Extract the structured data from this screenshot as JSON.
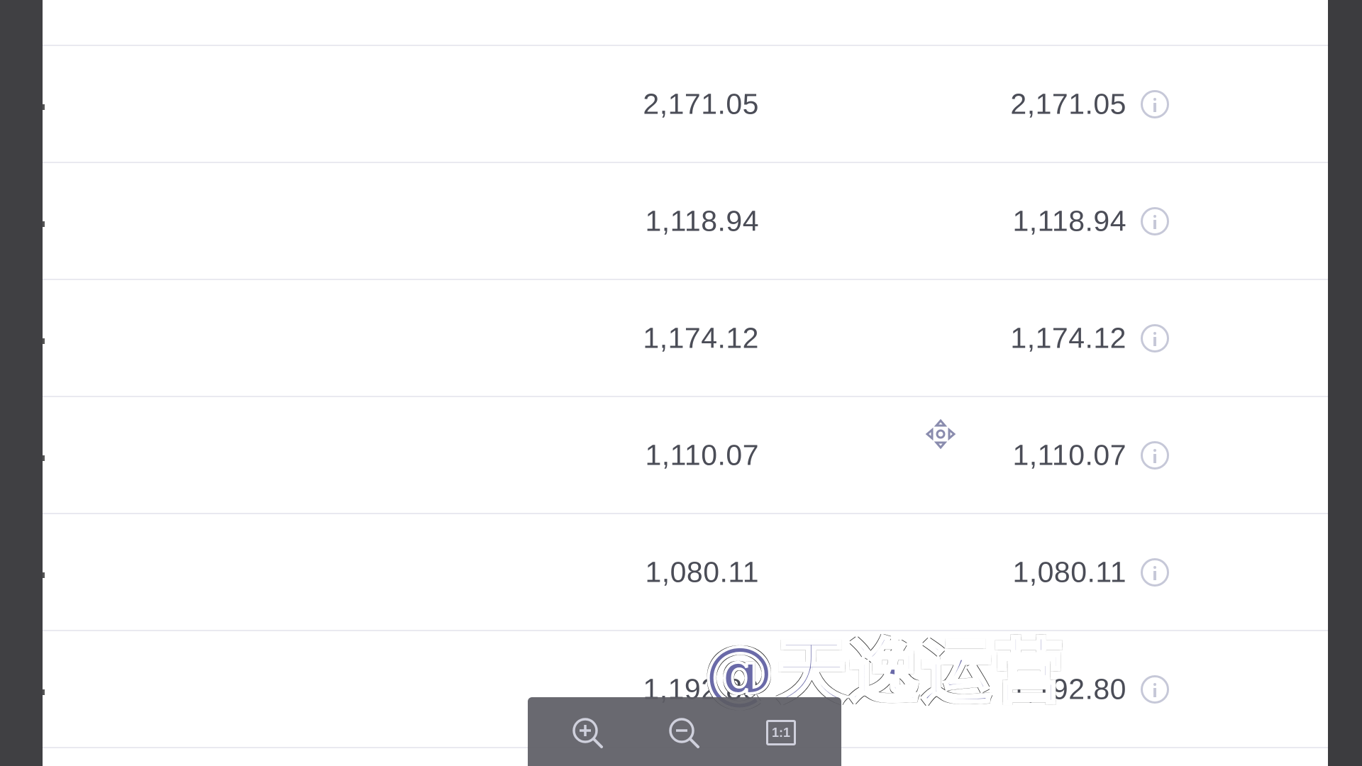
{
  "table": {
    "rows": [
      {
        "col_a": "2,171.05",
        "col_b": "2,171.05"
      },
      {
        "col_a": "1,118.94",
        "col_b": "1,118.94"
      },
      {
        "col_a": "1,174.12",
        "col_b": "1,174.12"
      },
      {
        "col_a": "1,110.07",
        "col_b": "1,110.07"
      },
      {
        "col_a": "1,080.11",
        "col_b": "1,080.11"
      },
      {
        "col_a": "1,192.80",
        "col_b": "1,192.80"
      }
    ]
  },
  "toolbar": {
    "zoom_in_icon": "zoom-in-icon",
    "zoom_out_icon": "zoom-out-icon",
    "actual_size_label": "1:1"
  },
  "watermark": {
    "text": "@天逸运营"
  },
  "colors": {
    "text": "#4b4d57",
    "icon": "#c6c8d8",
    "toolbar_bg": "#5c5c64",
    "viewer_bg": "#3c3c3f"
  }
}
